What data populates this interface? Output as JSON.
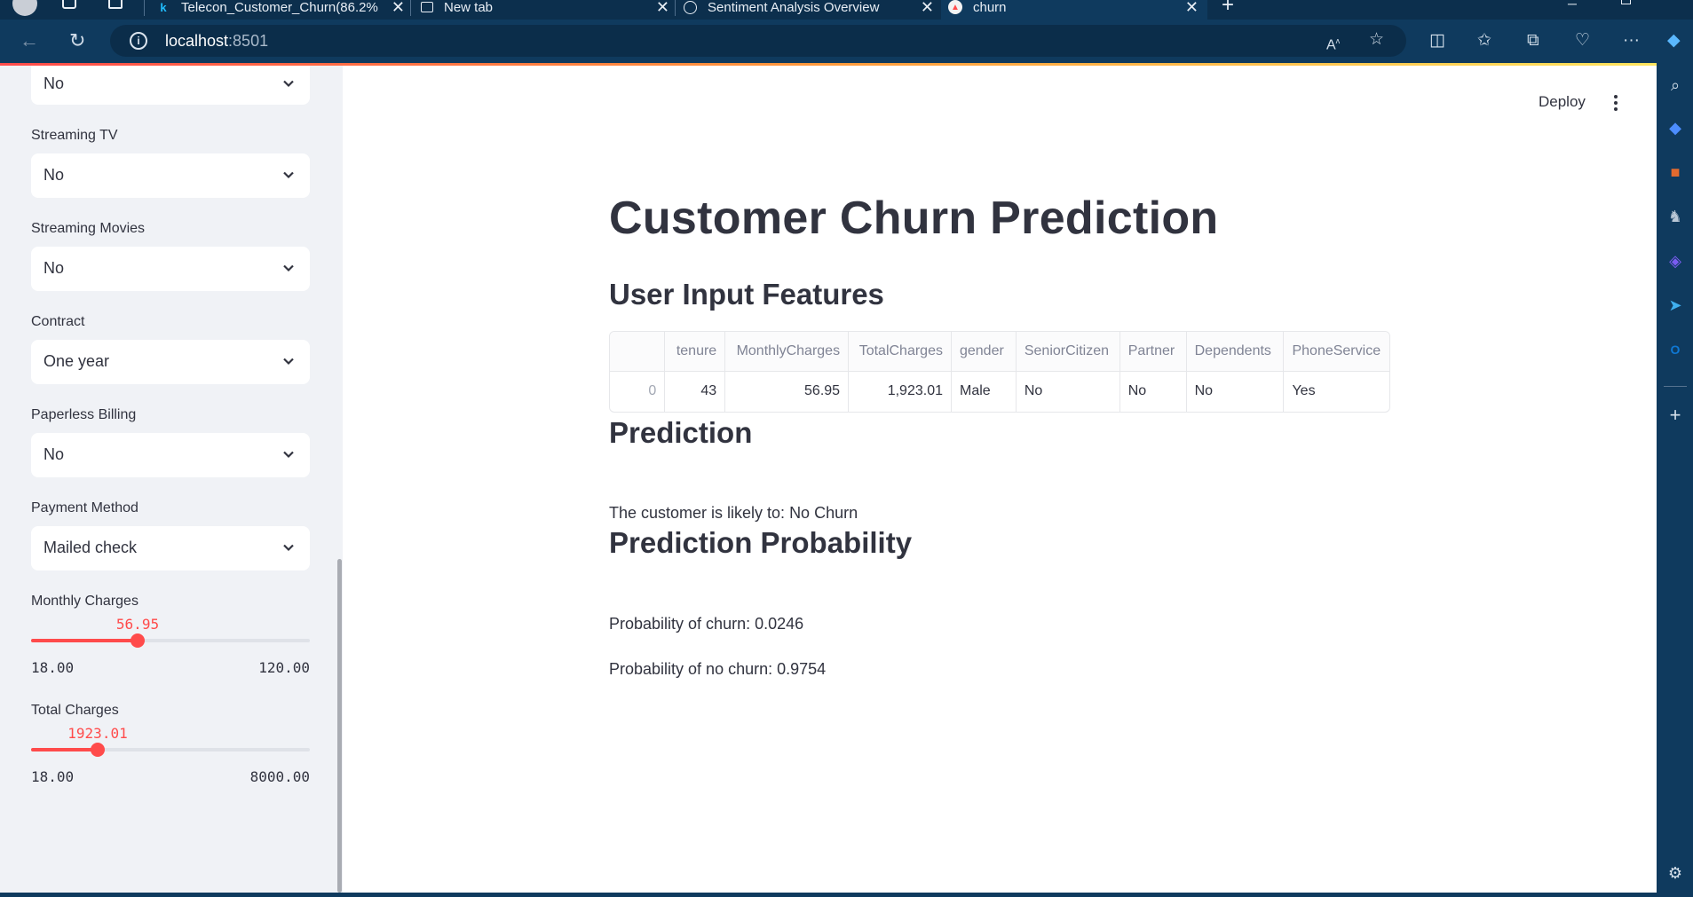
{
  "browser": {
    "tabs": [
      {
        "title": "Telecon_Customer_Churn(86.2%",
        "icon": "kaggle-icon"
      },
      {
        "title": "New tab",
        "icon": "newtab-icon"
      },
      {
        "title": "Sentiment Analysis Overview",
        "icon": "chatgpt-icon"
      },
      {
        "title": "churn",
        "icon": "streamlit-icon"
      }
    ],
    "address": {
      "host": "localhost",
      "port": ":8501"
    }
  },
  "header": {
    "deploy_label": "Deploy"
  },
  "sidebar": {
    "selects": [
      {
        "label": "",
        "value": "No"
      },
      {
        "label": "Streaming TV",
        "value": "No"
      },
      {
        "label": "Streaming Movies",
        "value": "No"
      },
      {
        "label": "Contract",
        "value": "One year"
      },
      {
        "label": "Paperless Billing",
        "value": "No"
      },
      {
        "label": "Payment Method",
        "value": "Mailed check"
      }
    ],
    "sliders": [
      {
        "label": "Monthly Charges",
        "value": "56.95",
        "min": "18.00",
        "max": "120.00",
        "fraction": 0.3819
      },
      {
        "label": "Total Charges",
        "value": "1923.01",
        "min": "18.00",
        "max": "8000.00",
        "fraction": 0.2387
      }
    ]
  },
  "main": {
    "title": "Customer Churn Prediction",
    "input_heading": "User Input Features",
    "table": {
      "columns": [
        "",
        "tenure",
        "MonthlyCharges",
        "TotalCharges",
        "gender",
        "SeniorCitizen",
        "Partner",
        "Dependents",
        "PhoneService"
      ],
      "rows": [
        [
          "0",
          "43",
          "56.95",
          "1,923.01",
          "Male",
          "No",
          "No",
          "No",
          "Yes"
        ]
      ]
    },
    "prediction_heading": "Prediction",
    "prediction_text": "The customer is likely to: No Churn",
    "probability_heading": "Prediction Probability",
    "prob_churn": "Probability of churn: 0.0246",
    "prob_no_churn": "Probability of no churn: 0.9754"
  }
}
